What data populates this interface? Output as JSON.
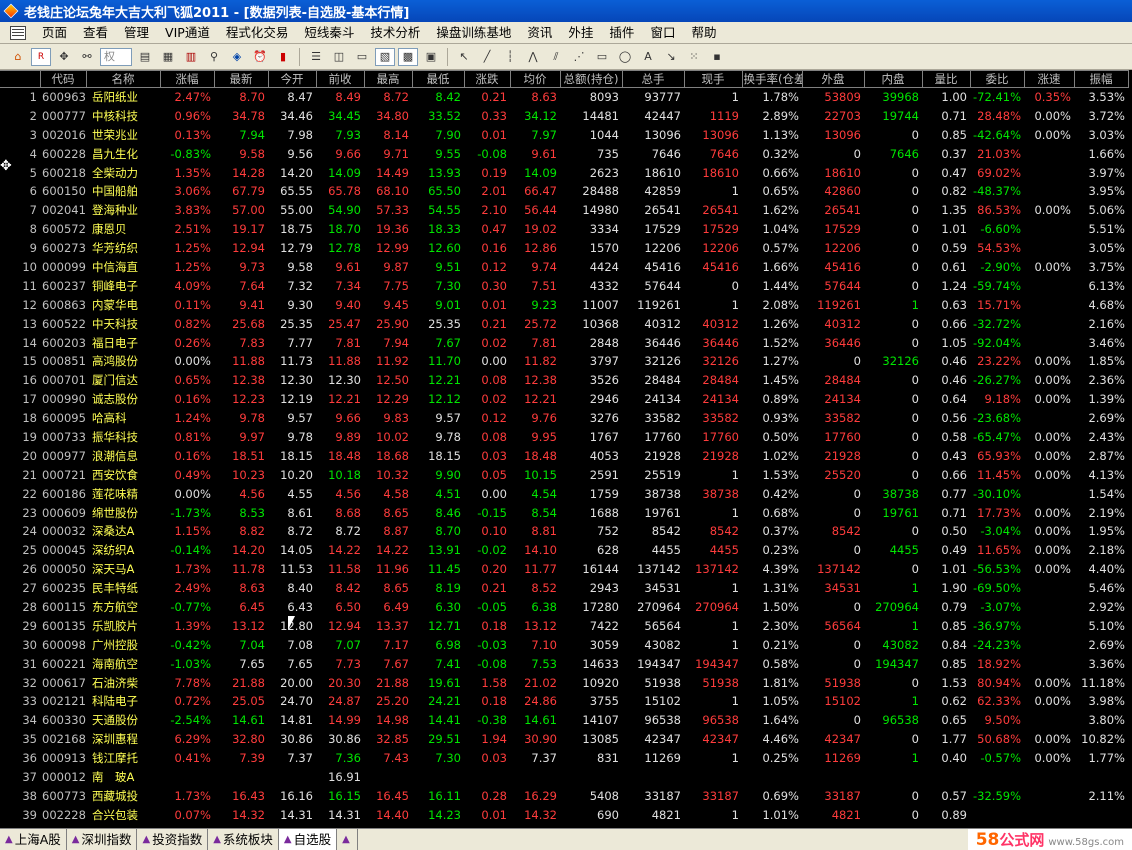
{
  "title": "老钱庄论坛兔年大吉大利飞狐2011 - [数据列表-自选股-基本行情]",
  "menu": [
    "页面",
    "查看",
    "管理",
    "VIP通道",
    "程式化交易",
    "短线秦斗",
    "技术分析",
    "操盘训练基地",
    "资讯",
    "外挂",
    "插件",
    "窗口",
    "帮助"
  ],
  "toolbar": {
    "combo_text": "权"
  },
  "columns": [
    "代码",
    "名称",
    "涨幅",
    "最新",
    "今开",
    "前收",
    "最高",
    "最低",
    "涨跌",
    "均价",
    "总额(持仓)",
    "总手",
    "现手",
    "换手率(仓差)",
    "外盘",
    "内盘",
    "量比",
    "委比",
    "涨速",
    "振幅"
  ],
  "rows": [
    [
      "1",
      "600963",
      "岳阳纸业",
      "2.47%",
      "8.70",
      "8.47",
      "8.49",
      "8.72",
      "8.42",
      "0.21",
      "8.63",
      "8093",
      "93777",
      "1",
      "1.78%",
      "53809",
      "39968",
      "1.00",
      "-72.41%",
      "0.35%",
      "3.53%"
    ],
    [
      "2",
      "000777",
      "中核科技",
      "0.96%",
      "34.78",
      "34.46",
      "34.45",
      "34.80",
      "33.52",
      "0.33",
      "34.12",
      "14481",
      "42447",
      "1119",
      "2.89%",
      "22703",
      "19744",
      "0.71",
      "28.48%",
      "0.00%",
      "3.72%"
    ],
    [
      "3",
      "002016",
      "世荣兆业",
      "0.13%",
      "7.94",
      "7.98",
      "7.93",
      "8.14",
      "7.90",
      "0.01",
      "7.97",
      "1044",
      "13096",
      "13096",
      "1.13%",
      "13096",
      "0",
      "0.85",
      "-42.64%",
      "0.00%",
      "3.03%"
    ],
    [
      "4",
      "600228",
      "昌九生化",
      "-0.83%",
      "9.58",
      "9.56",
      "9.66",
      "9.71",
      "9.55",
      "-0.08",
      "9.61",
      "735",
      "7646",
      "7646",
      "0.32%",
      "0",
      "7646",
      "0.37",
      "21.03%",
      "",
      "1.66%"
    ],
    [
      "5",
      "600218",
      "全柴动力",
      "1.35%",
      "14.28",
      "14.20",
      "14.09",
      "14.49",
      "13.93",
      "0.19",
      "14.09",
      "2623",
      "18610",
      "18610",
      "0.66%",
      "18610",
      "0",
      "0.47",
      "69.02%",
      "",
      "3.97%"
    ],
    [
      "6",
      "600150",
      "中国船舶",
      "3.06%",
      "67.79",
      "65.55",
      "65.78",
      "68.10",
      "65.50",
      "2.01",
      "66.47",
      "28488",
      "42859",
      "1",
      "0.65%",
      "42860",
      "0",
      "0.82",
      "-48.37%",
      "",
      "3.95%"
    ],
    [
      "7",
      "002041",
      "登海种业",
      "3.83%",
      "57.00",
      "55.00",
      "54.90",
      "57.33",
      "54.55",
      "2.10",
      "56.44",
      "14980",
      "26541",
      "26541",
      "1.62%",
      "26541",
      "0",
      "1.35",
      "86.53%",
      "0.00%",
      "5.06%"
    ],
    [
      "8",
      "600572",
      "康恩贝",
      "2.51%",
      "19.17",
      "18.75",
      "18.70",
      "19.36",
      "18.33",
      "0.47",
      "19.02",
      "3334",
      "17529",
      "17529",
      "1.04%",
      "17529",
      "0",
      "1.01",
      "-6.60%",
      "",
      "5.51%"
    ],
    [
      "9",
      "600273",
      "华芳纺织",
      "1.25%",
      "12.94",
      "12.79",
      "12.78",
      "12.99",
      "12.60",
      "0.16",
      "12.86",
      "1570",
      "12206",
      "12206",
      "0.57%",
      "12206",
      "0",
      "0.59",
      "54.53%",
      "",
      "3.05%"
    ],
    [
      "10",
      "000099",
      "中信海直",
      "1.25%",
      "9.73",
      "9.58",
      "9.61",
      "9.87",
      "9.51",
      "0.12",
      "9.74",
      "4424",
      "45416",
      "45416",
      "1.66%",
      "45416",
      "0",
      "0.61",
      "-2.90%",
      "0.00%",
      "3.75%"
    ],
    [
      "11",
      "600237",
      "铜峰电子",
      "4.09%",
      "7.64",
      "7.32",
      "7.34",
      "7.75",
      "7.30",
      "0.30",
      "7.51",
      "4332",
      "57644",
      "0",
      "1.44%",
      "57644",
      "0",
      "1.24",
      "-59.74%",
      "",
      "6.13%"
    ],
    [
      "12",
      "600863",
      "内蒙华电",
      "0.11%",
      "9.41",
      "9.30",
      "9.40",
      "9.45",
      "9.01",
      "0.01",
      "9.23",
      "11007",
      "119261",
      "1",
      "2.08%",
      "119261",
      "1",
      "0.63",
      "15.71%",
      "",
      "4.68%"
    ],
    [
      "13",
      "600522",
      "中天科技",
      "0.82%",
      "25.68",
      "25.35",
      "25.47",
      "25.90",
      "25.35",
      "0.21",
      "25.72",
      "10368",
      "40312",
      "40312",
      "1.26%",
      "40312",
      "0",
      "0.66",
      "-32.72%",
      "",
      "2.16%"
    ],
    [
      "14",
      "600203",
      "福日电子",
      "0.26%",
      "7.83",
      "7.77",
      "7.81",
      "7.94",
      "7.67",
      "0.02",
      "7.81",
      "2848",
      "36446",
      "36446",
      "1.52%",
      "36446",
      "0",
      "1.05",
      "-92.04%",
      "",
      "3.46%"
    ],
    [
      "15",
      "000851",
      "高鸿股份",
      "0.00%",
      "11.88",
      "11.73",
      "11.88",
      "11.92",
      "11.70",
      "0.00",
      "11.82",
      "3797",
      "32126",
      "32126",
      "1.27%",
      "0",
      "32126",
      "0.46",
      "23.22%",
      "0.00%",
      "1.85%"
    ],
    [
      "16",
      "000701",
      "厦门信达",
      "0.65%",
      "12.38",
      "12.30",
      "12.30",
      "12.50",
      "12.21",
      "0.08",
      "12.38",
      "3526",
      "28484",
      "28484",
      "1.45%",
      "28484",
      "0",
      "0.46",
      "-26.27%",
      "0.00%",
      "2.36%"
    ],
    [
      "17",
      "000990",
      "诚志股份",
      "0.16%",
      "12.23",
      "12.19",
      "12.21",
      "12.29",
      "12.12",
      "0.02",
      "12.21",
      "2946",
      "24134",
      "24134",
      "0.89%",
      "24134",
      "0",
      "0.64",
      "9.18%",
      "0.00%",
      "1.39%"
    ],
    [
      "18",
      "600095",
      "哈高科",
      "1.24%",
      "9.78",
      "9.57",
      "9.66",
      "9.83",
      "9.57",
      "0.12",
      "9.76",
      "3276",
      "33582",
      "33582",
      "0.93%",
      "33582",
      "0",
      "0.56",
      "-23.68%",
      "",
      "2.69%"
    ],
    [
      "19",
      "000733",
      "振华科技",
      "0.81%",
      "9.97",
      "9.78",
      "9.89",
      "10.02",
      "9.78",
      "0.08",
      "9.95",
      "1767",
      "17760",
      "17760",
      "0.50%",
      "17760",
      "0",
      "0.58",
      "-65.47%",
      "0.00%",
      "2.43%"
    ],
    [
      "20",
      "000977",
      "浪潮信息",
      "0.16%",
      "18.51",
      "18.15",
      "18.48",
      "18.68",
      "18.15",
      "0.03",
      "18.48",
      "4053",
      "21928",
      "21928",
      "1.02%",
      "21928",
      "0",
      "0.43",
      "65.93%",
      "0.00%",
      "2.87%"
    ],
    [
      "21",
      "000721",
      "西安饮食",
      "0.49%",
      "10.23",
      "10.20",
      "10.18",
      "10.32",
      "9.90",
      "0.05",
      "10.15",
      "2591",
      "25519",
      "1",
      "1.53%",
      "25520",
      "0",
      "0.66",
      "11.45%",
      "0.00%",
      "4.13%"
    ],
    [
      "22",
      "600186",
      "莲花味精",
      "0.00%",
      "4.56",
      "4.55",
      "4.56",
      "4.58",
      "4.51",
      "0.00",
      "4.54",
      "1759",
      "38738",
      "38738",
      "0.42%",
      "0",
      "38738",
      "0.77",
      "-30.10%",
      "",
      "1.54%"
    ],
    [
      "23",
      "000609",
      "绵世股份",
      "-1.73%",
      "8.53",
      "8.61",
      "8.68",
      "8.65",
      "8.46",
      "-0.15",
      "8.54",
      "1688",
      "19761",
      "1",
      "0.68%",
      "0",
      "19761",
      "0.71",
      "17.73%",
      "0.00%",
      "2.19%"
    ],
    [
      "24",
      "000032",
      "深桑达A",
      "1.15%",
      "8.82",
      "8.72",
      "8.72",
      "8.87",
      "8.70",
      "0.10",
      "8.81",
      "752",
      "8542",
      "8542",
      "0.37%",
      "8542",
      "0",
      "0.50",
      "-3.04%",
      "0.00%",
      "1.95%"
    ],
    [
      "25",
      "000045",
      "深纺织A",
      "-0.14%",
      "14.20",
      "14.05",
      "14.22",
      "14.22",
      "13.91",
      "-0.02",
      "14.10",
      "628",
      "4455",
      "4455",
      "0.23%",
      "0",
      "4455",
      "0.49",
      "11.65%",
      "0.00%",
      "2.18%"
    ],
    [
      "26",
      "000050",
      "深天马A",
      "1.73%",
      "11.78",
      "11.53",
      "11.58",
      "11.96",
      "11.45",
      "0.20",
      "11.77",
      "16144",
      "137142",
      "137142",
      "4.39%",
      "137142",
      "0",
      "1.01",
      "-56.53%",
      "0.00%",
      "4.40%"
    ],
    [
      "27",
      "600235",
      "民丰特纸",
      "2.49%",
      "8.63",
      "8.40",
      "8.42",
      "8.65",
      "8.19",
      "0.21",
      "8.52",
      "2943",
      "34531",
      "1",
      "1.31%",
      "34531",
      "1",
      "1.90",
      "-69.50%",
      "",
      "5.46%"
    ],
    [
      "28",
      "600115",
      "东方航空",
      "-0.77%",
      "6.45",
      "6.43",
      "6.50",
      "6.49",
      "6.30",
      "-0.05",
      "6.38",
      "17280",
      "270964",
      "270964",
      "1.50%",
      "0",
      "270964",
      "0.79",
      "-3.07%",
      "",
      "2.92%"
    ],
    [
      "29",
      "600135",
      "乐凯胶片",
      "1.39%",
      "13.12",
      "12.80",
      "12.94",
      "13.37",
      "12.71",
      "0.18",
      "13.12",
      "7422",
      "56564",
      "1",
      "2.30%",
      "56564",
      "1",
      "0.85",
      "-36.97%",
      "",
      "5.10%"
    ],
    [
      "30",
      "600098",
      "广州控股",
      "-0.42%",
      "7.04",
      "7.08",
      "7.07",
      "7.17",
      "6.98",
      "-0.03",
      "7.10",
      "3059",
      "43082",
      "1",
      "0.21%",
      "0",
      "43082",
      "0.84",
      "-24.23%",
      "",
      "2.69%"
    ],
    [
      "31",
      "600221",
      "海南航空",
      "-1.03%",
      "7.65",
      "7.65",
      "7.73",
      "7.67",
      "7.41",
      "-0.08",
      "7.53",
      "14633",
      "194347",
      "194347",
      "0.58%",
      "0",
      "194347",
      "0.85",
      "18.92%",
      "",
      "3.36%"
    ],
    [
      "32",
      "000617",
      "石油济柴",
      "7.78%",
      "21.88",
      "20.00",
      "20.30",
      "21.88",
      "19.61",
      "1.58",
      "21.02",
      "10920",
      "51938",
      "51938",
      "1.81%",
      "51938",
      "0",
      "1.53",
      "80.94%",
      "0.00%",
      "11.18%"
    ],
    [
      "33",
      "002121",
      "科陆电子",
      "0.72%",
      "25.05",
      "24.70",
      "24.87",
      "25.20",
      "24.21",
      "0.18",
      "24.86",
      "3755",
      "15102",
      "1",
      "1.05%",
      "15102",
      "1",
      "0.62",
      "62.33%",
      "0.00%",
      "3.98%"
    ],
    [
      "34",
      "600330",
      "天通股份",
      "-2.54%",
      "14.61",
      "14.81",
      "14.99",
      "14.98",
      "14.41",
      "-0.38",
      "14.61",
      "14107",
      "96538",
      "96538",
      "1.64%",
      "0",
      "96538",
      "0.65",
      "9.50%",
      "",
      "3.80%"
    ],
    [
      "35",
      "002168",
      "深圳惠程",
      "6.29%",
      "32.80",
      "30.86",
      "30.86",
      "32.85",
      "29.51",
      "1.94",
      "30.90",
      "13085",
      "42347",
      "42347",
      "4.46%",
      "42347",
      "0",
      "1.77",
      "50.68%",
      "0.00%",
      "10.82%"
    ],
    [
      "36",
      "000913",
      "钱江摩托",
      "0.41%",
      "7.39",
      "7.37",
      "7.36",
      "7.43",
      "7.30",
      "0.03",
      "7.37",
      "831",
      "11269",
      "1",
      "0.25%",
      "11269",
      "1",
      "0.40",
      "-0.57%",
      "0.00%",
      "1.77%"
    ],
    [
      "37",
      "000012",
      "南　玻A",
      "",
      "",
      "",
      "16.91",
      "",
      "",
      "",
      "",
      "",
      "",
      "",
      "",
      "",
      "",
      "",
      "",
      "",
      ""
    ],
    [
      "38",
      "600773",
      "西藏城投",
      "1.73%",
      "16.43",
      "16.16",
      "16.15",
      "16.45",
      "16.11",
      "0.28",
      "16.29",
      "5408",
      "33187",
      "33187",
      "0.69%",
      "33187",
      "0",
      "0.57",
      "-32.59%",
      "",
      "2.11%"
    ],
    [
      "39",
      "002228",
      "合兴包装",
      "0.07%",
      "14.32",
      "14.31",
      "14.31",
      "14.40",
      "14.23",
      "0.01",
      "14.32",
      "690",
      "4821",
      "1",
      "1.01%",
      "4821",
      "0",
      "0.89",
      "",
      "",
      ""
    ]
  ],
  "tabs": [
    "上海A股",
    "深圳指数",
    "投资指数",
    "系统板块",
    "自选股",
    ""
  ],
  "watermark": {
    "a": "58",
    "b": "公式网",
    "c": "www.58gs.com"
  }
}
